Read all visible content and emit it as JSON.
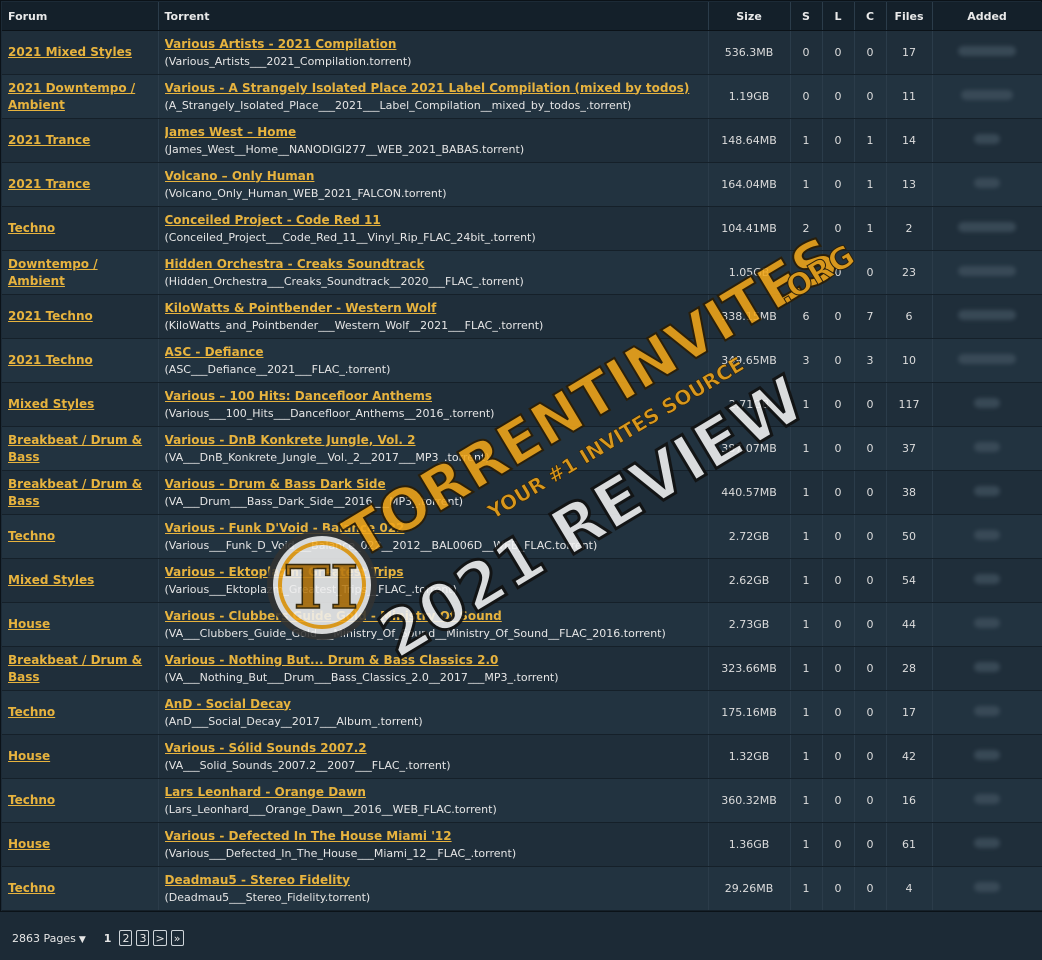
{
  "table": {
    "headers": {
      "forum": "Forum",
      "torrent": "Torrent",
      "size": "Size",
      "s": "S",
      "l": "L",
      "c": "C",
      "files": "Files",
      "added": "Added"
    },
    "rows": [
      {
        "forum": "2021 Mixed Styles",
        "name": "Various Artists - 2021 Compilation",
        "file": "(Various_Artists___2021_Compilation.torrent)",
        "size": "536.3MB",
        "s": "0",
        "l": "0",
        "c": "0",
        "files": "17"
      },
      {
        "forum": "2021 Downtempo / Ambient",
        "name": "Various - A Strangely Isolated Place 2021 Label Compilation (mixed by todos)",
        "file": "(A_Strangely_Isolated_Place___2021___Label_Compilation__mixed_by_todos_.torrent)",
        "size": "1.19GB",
        "s": "0",
        "l": "0",
        "c": "0",
        "files": "11"
      },
      {
        "forum": "2021 Trance",
        "name": "James West – Home",
        "file": "(James_West__Home__NANODIGI277__WEB_2021_BABAS.torrent)",
        "size": "148.64MB",
        "s": "1",
        "l": "0",
        "c": "1",
        "files": "14"
      },
      {
        "forum": "2021 Trance",
        "name": "Volcano – Only Human",
        "file": "(Volcano_Only_Human_WEB_2021_FALCON.torrent)",
        "size": "164.04MB",
        "s": "1",
        "l": "0",
        "c": "1",
        "files": "13"
      },
      {
        "forum": "Techno",
        "name": "Conceiled Project - Code Red 11",
        "file": "(Conceiled_Project___Code_Red_11__Vinyl_Rip_FLAC_24bit_.torrent)",
        "size": "104.41MB",
        "s": "2",
        "l": "0",
        "c": "1",
        "files": "2"
      },
      {
        "forum": "Downtempo / Ambient",
        "name": "Hidden Orchestra - Creaks Soundtrack",
        "file": "(Hidden_Orchestra___Creaks_Soundtrack__2020___FLAC_.torrent)",
        "size": "1.05GB",
        "s": "",
        "l": "0",
        "c": "0",
        "files": "23"
      },
      {
        "forum": "2021 Techno",
        "name": "KiloWatts & Pointbender - Western Wolf",
        "file": "(KiloWatts_and_Pointbender___Western_Wolf__2021___FLAC_.torrent)",
        "size": "338.15MB",
        "s": "6",
        "l": "0",
        "c": "7",
        "files": "6"
      },
      {
        "forum": "2021 Techno",
        "name": "ASC - Defiance",
        "file": "(ASC___Defiance__2021___FLAC_.torrent)",
        "size": "349.65MB",
        "s": "3",
        "l": "0",
        "c": "3",
        "files": "10"
      },
      {
        "forum": "Mixed Styles",
        "name": "Various – 100 Hits: Dancefloor Anthems",
        "file": "(Various___100_Hits___Dancefloor_Anthems__2016_.torrent)",
        "size": "2.71GB",
        "s": "1",
        "l": "0",
        "c": "0",
        "files": "117"
      },
      {
        "forum": "Breakbeat / Drum & Bass",
        "name": "Various - DnB Konkrete Jungle, Vol. 2",
        "file": "(VA___DnB_Konkrete_Jungle__Vol._2__2017___MP3_.torrent)",
        "size": "387.07MB",
        "s": "1",
        "l": "0",
        "c": "0",
        "files": "37"
      },
      {
        "forum": "Breakbeat / Drum & Bass",
        "name": "Various - Drum & Bass Dark Side",
        "file": "(VA___Drum___Bass_Dark_Side__2016___MP3_.torrent)",
        "size": "440.57MB",
        "s": "1",
        "l": "0",
        "c": "0",
        "files": "38"
      },
      {
        "forum": "Techno",
        "name": "Various - Funk D'Void - Balance 022",
        "file": "(Various___Funk_D_Void___Balance_022__2012__BAL006D__WEB_FLAC.torrent)",
        "size": "2.72GB",
        "s": "1",
        "l": "0",
        "c": "0",
        "files": "50"
      },
      {
        "forum": "Mixed Styles",
        "name": "Various - Ektoplazm: Greatest Trips",
        "file": "(Various___Ektoplazm_Greatest_Trips__FLAC_.torrent)",
        "size": "2.62GB",
        "s": "1",
        "l": "0",
        "c": "0",
        "files": "54"
      },
      {
        "forum": "House",
        "name": "Various - Clubbers Guide Gold - Ministry Of Sound",
        "file": "(VA___Clubbers_Guide_Gold___Ministry_Of_Sound__Ministry_Of_Sound__FLAC_2016.torrent)",
        "size": "2.73GB",
        "s": "1",
        "l": "0",
        "c": "0",
        "files": "44"
      },
      {
        "forum": "Breakbeat / Drum & Bass",
        "name": "Various - Nothing But... Drum & Bass Classics 2.0",
        "file": "(VA___Nothing_But___Drum___Bass_Classics_2.0__2017___MP3_.torrent)",
        "size": "323.66MB",
        "s": "1",
        "l": "0",
        "c": "0",
        "files": "28"
      },
      {
        "forum": "Techno",
        "name": "AnD - Social Decay",
        "file": "(AnD___Social_Decay__2017___Album_.torrent)",
        "size": "175.16MB",
        "s": "1",
        "l": "0",
        "c": "0",
        "files": "17"
      },
      {
        "forum": "House",
        "name": "Various - Sólid Sounds 2007.2",
        "file": "(VA___Solid_Sounds_2007.2__2007___FLAC_.torrent)",
        "size": "1.32GB",
        "s": "1",
        "l": "0",
        "c": "0",
        "files": "42"
      },
      {
        "forum": "Techno",
        "name": "Lars Leonhard - Orange Dawn",
        "file": "(Lars_Leonhard___Orange_Dawn__2016__WEB_FLAC.torrent)",
        "size": "360.32MB",
        "s": "1",
        "l": "0",
        "c": "0",
        "files": "16"
      },
      {
        "forum": "House",
        "name": "Various - Defected In The House Miami '12",
        "file": "(Various___Defected_In_The_House___Miami_12__FLAC_.torrent)",
        "size": "1.36GB",
        "s": "1",
        "l": "0",
        "c": "0",
        "files": "61"
      },
      {
        "forum": "Techno",
        "name": "Deadmau5 - Stereo Fidelity",
        "file": "(Deadmau5___Stereo_Fidelity.torrent)",
        "size": "29.26MB",
        "s": "1",
        "l": "0",
        "c": "0",
        "files": "4"
      }
    ]
  },
  "pager": {
    "pages_label": "2863 Pages",
    "current": "1",
    "p2": "2",
    "p3": "3",
    "next": ">",
    "last": "»"
  },
  "watermark": {
    "domain": "TORRENTINVITES",
    "tld": ".ORG",
    "tagline": "YOUR #1 INVITES SOURCE",
    "review": "2021 REVIEW",
    "logo": "TI"
  },
  "colors": {
    "background": "#1c2a36",
    "header": "#14202a",
    "link": "#e7b33e",
    "watermark_orange": "#f2a619"
  }
}
